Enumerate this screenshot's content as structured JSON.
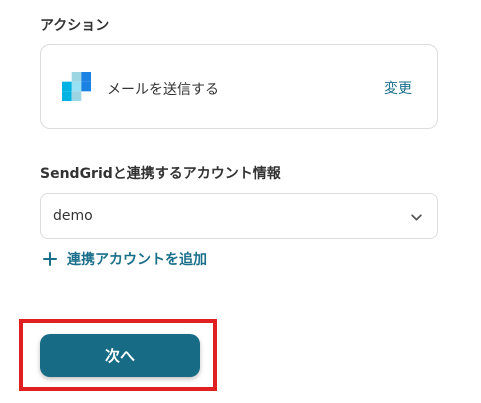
{
  "action_section": {
    "label": "アクション",
    "app_icon": "sendgrid-logo-icon",
    "action_name": "メールを送信する",
    "change_label": "変更"
  },
  "account_section": {
    "label": "SendGridと連携するアカウント情報",
    "selected_value": "demo",
    "add_account_label": "連携アカウントを追加"
  },
  "footer": {
    "next_label": "次へ"
  },
  "colors": {
    "accent": "#1a6f8a",
    "button_bg": "#186b84",
    "highlight": "#e02020",
    "border": "#dcdcdc"
  }
}
